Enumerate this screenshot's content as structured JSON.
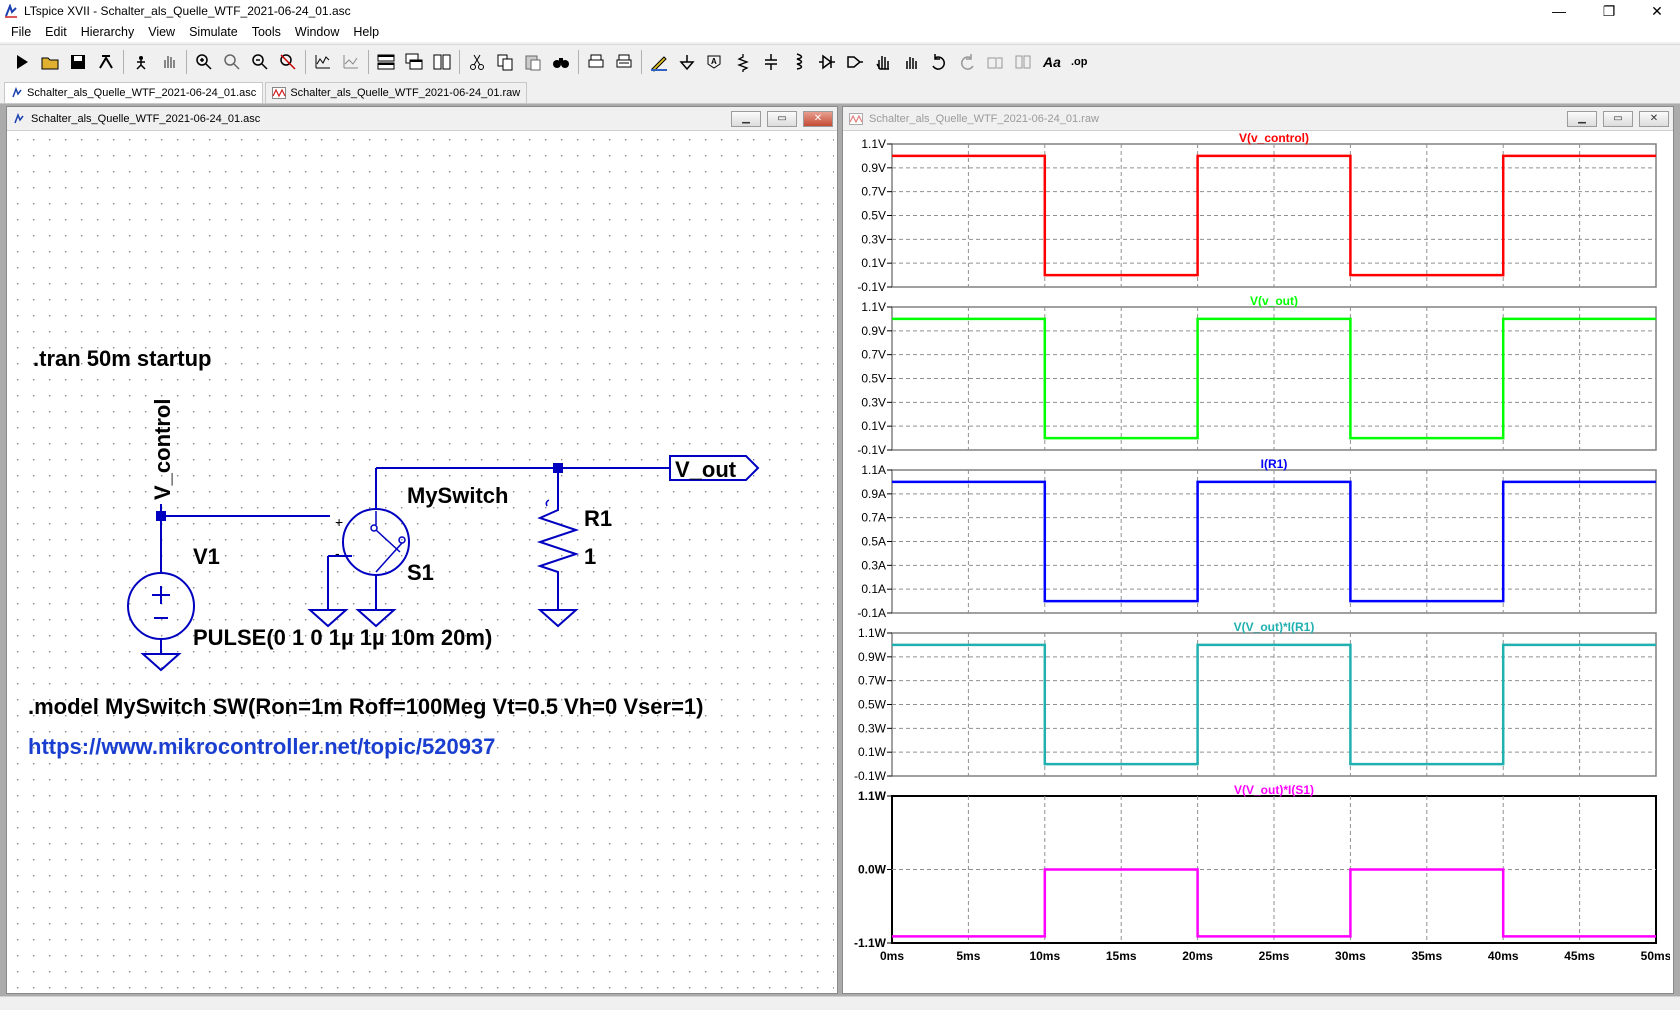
{
  "window": {
    "title": "LTspice XVII - Schalter_als_Quelle_WTF_2021-06-24_01.asc",
    "minimize": "—",
    "maximize": "❐",
    "close": "✕"
  },
  "menu": [
    "File",
    "Edit",
    "Hierarchy",
    "View",
    "Simulate",
    "Tools",
    "Window",
    "Help"
  ],
  "toolbar_icons": [
    "run-icon",
    "open-icon",
    "save-icon",
    "control-panel-icon",
    "halt-icon",
    "pan-icon",
    "zoom-in-icon",
    "zoom-rect-icon",
    "zoom-out-icon",
    "zoom-cancel-icon",
    "autorange-icon",
    "plot-settings-icon",
    "tile-horizontal-icon",
    "cascade-icon",
    "tile-vertical-icon",
    "cut-icon",
    "copy-icon",
    "paste-icon",
    "find-icon",
    "print-icon",
    "print-preview-icon",
    "draw-wire-icon",
    "ground-icon",
    "label-net-icon",
    "resistor-icon",
    "capacitor-icon",
    "inductor-icon",
    "diode-icon",
    "component-icon",
    "move-icon",
    "drag-icon",
    "undo-icon",
    "redo-icon",
    "rotate-icon",
    "mirror-icon",
    "text-icon",
    "spice-directive-icon"
  ],
  "tabs": [
    "Schalter_als_Quelle_WTF_2021-06-24_01.asc",
    "Schalter_als_Quelle_WTF_2021-06-24_01.raw"
  ],
  "schematic": {
    "title": "Schalter_als_Quelle_WTF_2021-06-24_01.asc",
    "tran": ".tran 50m startup",
    "net_v_control": "V_control",
    "net_v_out": "V_out",
    "switch_model": "MySwitch",
    "switch_name": "S1",
    "resistor_name": "R1",
    "resistor_value": "1",
    "source_name": "V1",
    "source_value": "PULSE(0 1 0 1µ 1µ 10m 20m)",
    "model_line": ".model MySwitch SW(Ron=1m Roff=100Meg Vt=0.5 Vh=0 Vser=1)",
    "url": "https://www.mikrocontroller.net/topic/520937",
    "plus": "+",
    "minus": "-"
  },
  "plot_window": {
    "title": "Schalter_als_Quelle_WTF_2021-06-24_01.raw"
  },
  "chart_data": {
    "type": "line",
    "x_ticks": [
      "0ms",
      "5ms",
      "10ms",
      "15ms",
      "20ms",
      "25ms",
      "30ms",
      "35ms",
      "40ms",
      "45ms",
      "50ms"
    ],
    "xlim": [
      0,
      50
    ],
    "transitions_ms": [
      0,
      10,
      20,
      30,
      40,
      50
    ],
    "panes": [
      {
        "title": "V(v_control)",
        "color": "#ff0000",
        "ylim": [
          -0.1,
          1.1
        ],
        "y_ticks": [
          "1.1V",
          "0.9V",
          "0.7V",
          "0.5V",
          "0.3V",
          "0.1V",
          "-0.1V"
        ],
        "high": 1,
        "low": 0,
        "starts_high": true
      },
      {
        "title": "V(v_out)",
        "color": "#00ff00",
        "ylim": [
          -0.1,
          1.1
        ],
        "y_ticks": [
          "1.1V",
          "0.9V",
          "0.7V",
          "0.5V",
          "0.3V",
          "0.1V",
          "-0.1V"
        ],
        "high": 1,
        "low": 0,
        "starts_high": true
      },
      {
        "title": "I(R1)",
        "color": "#0000ff",
        "ylim": [
          -0.1,
          1.1
        ],
        "y_ticks": [
          "1.1A",
          "0.9A",
          "0.7A",
          "0.5A",
          "0.3A",
          "0.1A",
          "-0.1A"
        ],
        "high": 1,
        "low": 0,
        "starts_high": true
      },
      {
        "title": "V(V_out)*I(R1)",
        "color": "#20b0b0",
        "ylim": [
          -0.1,
          1.1
        ],
        "y_ticks": [
          "1.1W",
          "0.9W",
          "0.7W",
          "0.5W",
          "0.3W",
          "0.1W",
          "-0.1W"
        ],
        "high": 1,
        "low": 0,
        "starts_high": true
      },
      {
        "title": "V(V_out)*I(S1)",
        "color": "#ff00ff",
        "ylim": [
          -1.1,
          1.1
        ],
        "y_ticks": [
          "1.1W",
          "0.0W",
          "-1.1W"
        ],
        "high": 0,
        "low": -1,
        "starts_high": false
      }
    ]
  }
}
